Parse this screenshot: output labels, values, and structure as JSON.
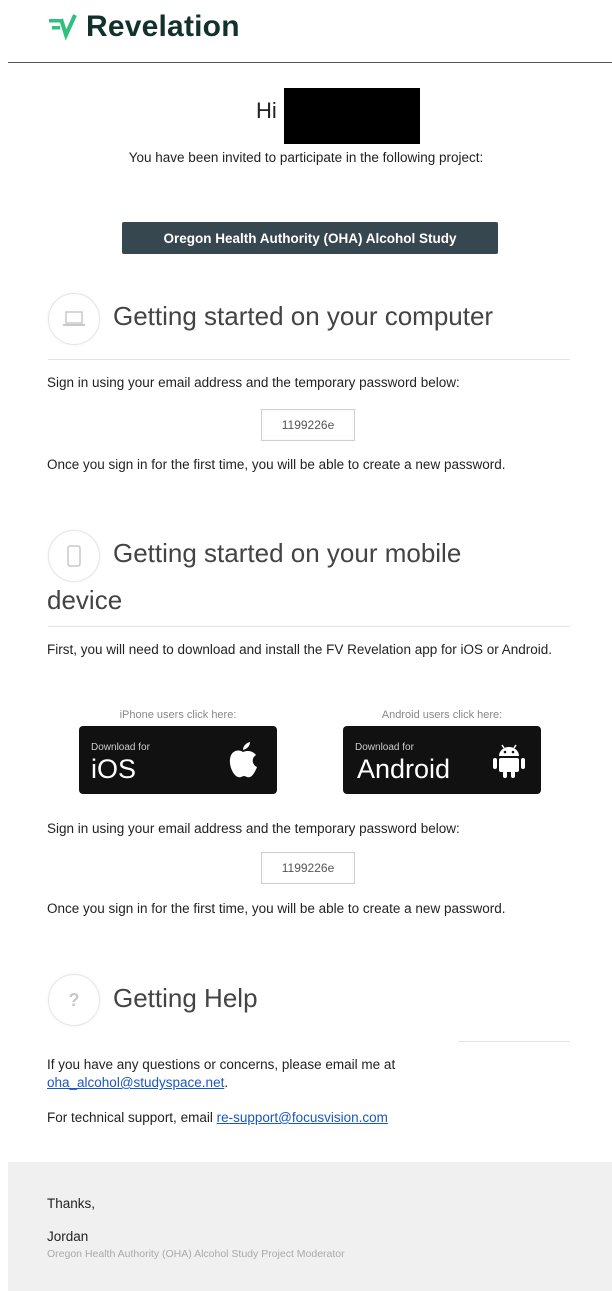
{
  "header": {
    "brand": "Revelation"
  },
  "greeting": {
    "hi": "Hi"
  },
  "invite": {
    "text": "You have been invited to participate in the following project:",
    "project": "Oregon Health Authority (OHA) Alcohol Study"
  },
  "computer": {
    "title": "Getting started on your computer",
    "instructions": "Sign in using your email address and the temporary password below:",
    "password": "1199226e",
    "note": "Once you sign in for the first time, you will be able to create a new password."
  },
  "mobile": {
    "title_line1": "Getting started on your mobile",
    "title_line2": "device",
    "intro": "First, you will need to download and install the FV Revelation app for iOS or Android.",
    "ios": {
      "caption": "iPhone users click here:",
      "small": "Download for",
      "big": "iOS",
      "icon": "apple-icon"
    },
    "android": {
      "caption": "Android users click here:",
      "small": "Download for",
      "big": "Android",
      "icon": "android-icon"
    },
    "instructions": "Sign in using your email address and the temporary password below:",
    "password": "1199226e",
    "note": "Once you sign in for the first time, you will be able to create a new password."
  },
  "help": {
    "title": "Getting Help",
    "line1": "If you have any questions or concerns, please email me at",
    "email": "oha_alcohol@studyspace.net",
    "email_suffix": ".",
    "support_prefix": "For technical support, email",
    "support_email": "re-support@focusvision.com"
  },
  "footer": {
    "thanks": "Thanks,",
    "name": "Jordan",
    "role": "Oregon Health Authority (OHA) Alcohol Study Project Moderator"
  },
  "colors": {
    "brand_green": "#2ec27e",
    "brand_dark": "#12312d",
    "pill_bg": "#37474f",
    "link": "#1a56c4"
  }
}
